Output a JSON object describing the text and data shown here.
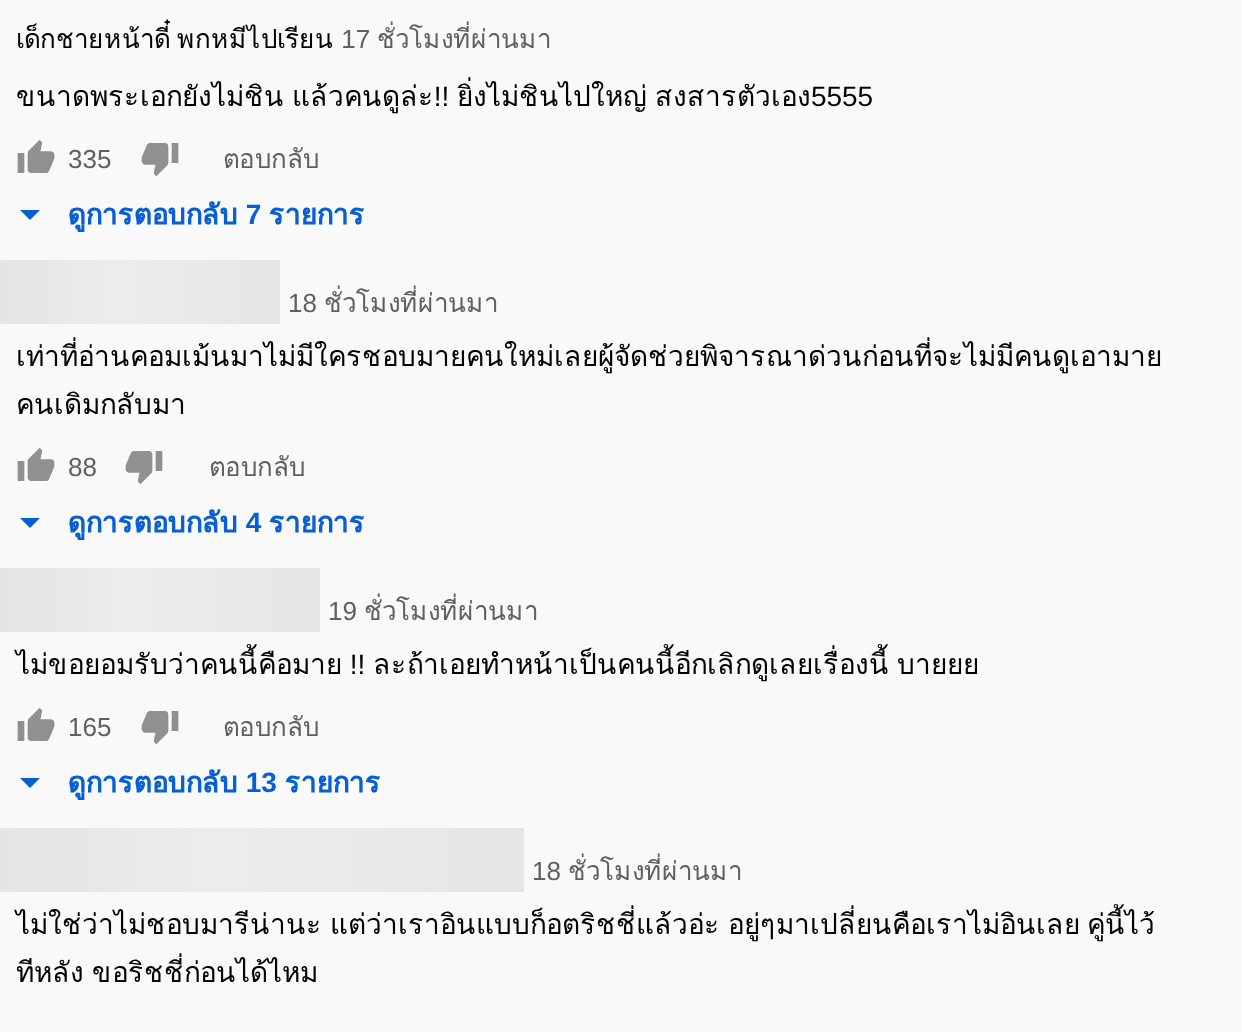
{
  "comments": [
    {
      "redacted": false,
      "author": "เด็กชายหน้าดี๋ พกหมีไปเรียน",
      "time": "17 ชั่วโมงที่ผ่านมา",
      "text": "ขนาดพระเอกยังไม่ชิน แล้วคนดูล่ะ!! ยิ่งไม่ชินไปใหญ่ สงสารตัวเอง5555",
      "likes": "335",
      "reply": "ตอบกลับ",
      "view_replies": "ดูการตอบกลับ 7 รายการ"
    },
    {
      "redacted": true,
      "time": "18 ชั่วโมงที่ผ่านมา",
      "text": "เท่าที่อ่านคอมเม้นมาไม่มีใครชอบมายคนใหม่เลยผู้จัดช่วยพิจารณาด่วนก่อนที่จะไม่มีคนดูเอามาย คนเดิมกลับมา",
      "likes": "88",
      "reply": "ตอบกลับ",
      "view_replies": "ดูการตอบกลับ 4 รายการ"
    },
    {
      "redacted": true,
      "time": "19 ชั่วโมงที่ผ่านมา",
      "text": "ไม่ขอยอมรับว่าคนนี้คือมาย !! ละถ้าเอยทำหน้าเป็นคนนี้อีกเลิกดูเลยเรื่องนี้ บายยย",
      "likes": "165",
      "reply": "ตอบกลับ",
      "view_replies": "ดูการตอบกลับ 13 รายการ"
    },
    {
      "redacted": true,
      "time": "18 ชั่วโมงที่ผ่านมา",
      "text": "ไม่ใช่ว่าไม่ชอบมารีน่านะ แต่ว่าเราอินแบบก็อตริชชี่แล้วอ่ะ อยู่ๆมาเปลี่ยนคือเราไม่อินเลย คู่นี้ไว้ ทีหลัง ขอริชชี่ก่อนได้ไหม"
    }
  ]
}
